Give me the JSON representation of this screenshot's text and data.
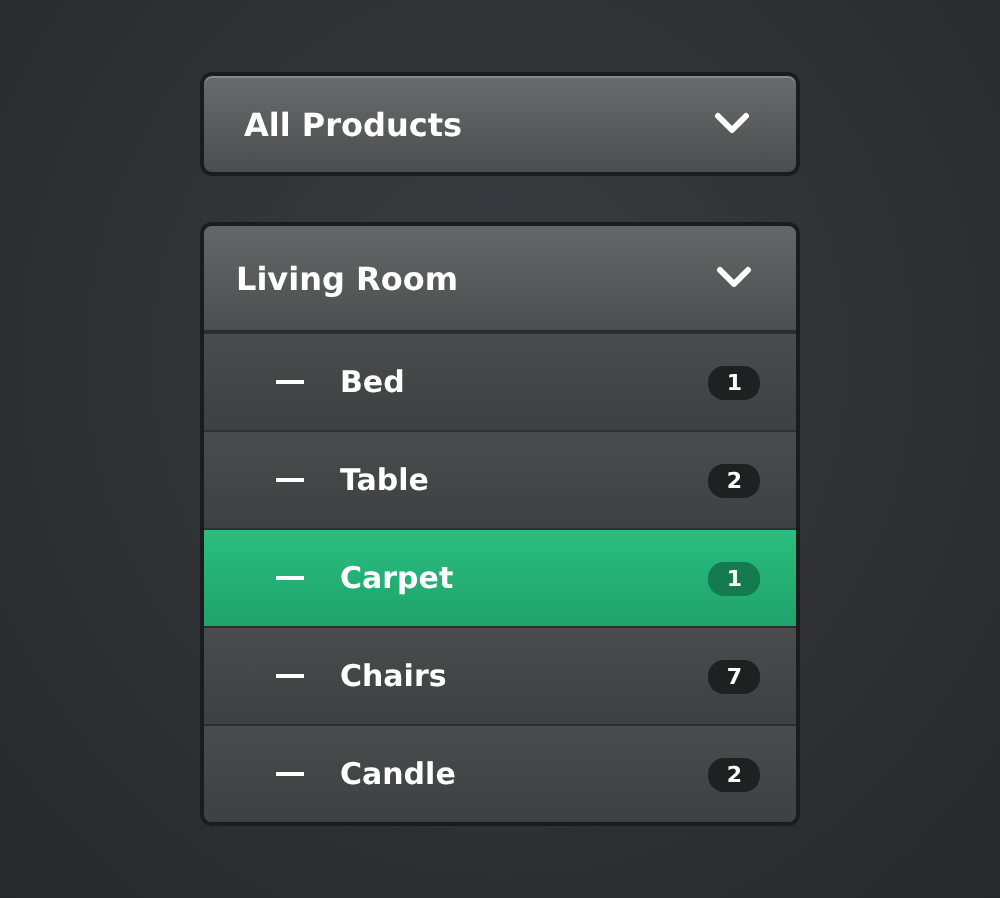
{
  "dropdown": {
    "label": "All Products"
  },
  "category": {
    "label": "Living Room",
    "expanded": true,
    "items": [
      {
        "label": "Bed",
        "count": "1",
        "selected": false
      },
      {
        "label": "Table",
        "count": "2",
        "selected": false
      },
      {
        "label": "Carpet",
        "count": "1",
        "selected": true
      },
      {
        "label": "Chairs",
        "count": "7",
        "selected": false
      },
      {
        "label": "Candle",
        "count": "2",
        "selected": false
      }
    ]
  }
}
